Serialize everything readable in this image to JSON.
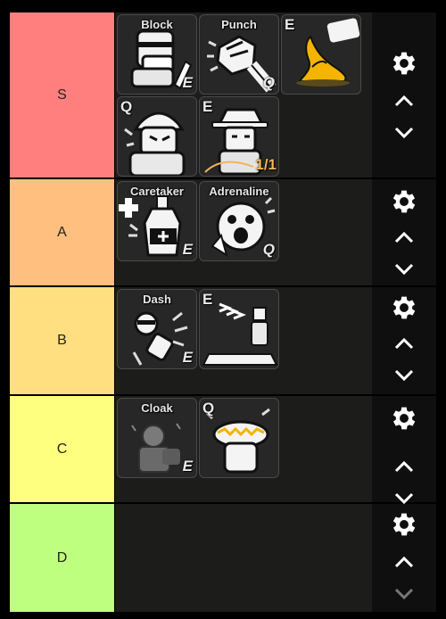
{
  "tiers": [
    {
      "label": "S",
      "color": "#ff7f7f",
      "items": [
        {
          "name": "Block",
          "key": "E",
          "key_pos": "br"
        },
        {
          "name": "Punch",
          "key": "Q",
          "key_pos": "br"
        },
        {
          "name": "",
          "key": "E",
          "key_pos": "tl"
        },
        {
          "name": "",
          "key": "Q",
          "key_pos": "tl"
        },
        {
          "name": "",
          "key": "E",
          "key_pos": "tl",
          "charge": "1/1"
        }
      ]
    },
    {
      "label": "A",
      "color": "#ffbf7f",
      "items": [
        {
          "name": "Caretaker",
          "key": "E",
          "key_pos": "br"
        },
        {
          "name": "Adrenaline",
          "key": "Q",
          "key_pos": "br"
        }
      ]
    },
    {
      "label": "B",
      "color": "#ffdf7f",
      "items": [
        {
          "name": "Dash",
          "key": "E",
          "key_pos": "br"
        },
        {
          "name": "",
          "key": "E",
          "key_pos": "tl"
        }
      ]
    },
    {
      "label": "C",
      "color": "#ffff7f",
      "items": [
        {
          "name": "Cloak",
          "key": "E",
          "key_pos": "br"
        },
        {
          "name": "",
          "key": "Q",
          "key_pos": "tl"
        }
      ]
    },
    {
      "label": "D",
      "color": "#bfff7f",
      "items": []
    }
  ],
  "icons": {
    "settings": "gear-icon",
    "move_up": "chevron-up-icon",
    "move_down": "chevron-down-icon"
  }
}
